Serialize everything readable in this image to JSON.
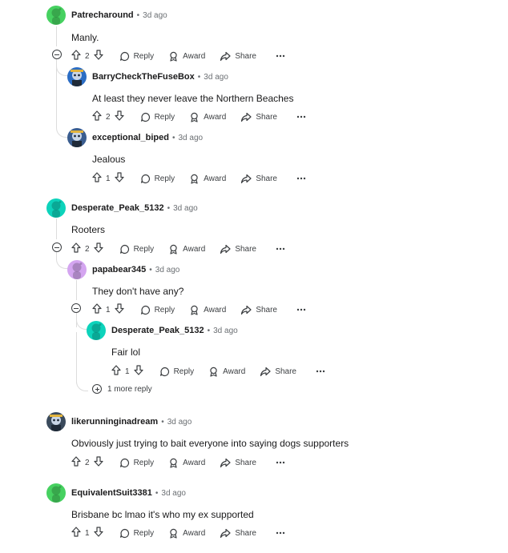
{
  "comments": [
    {
      "user": "Patrecharound",
      "time": "3d ago",
      "text": "Manly.",
      "votes": "2",
      "avatar_color": "#46d160"
    },
    {
      "user": "BarryCheckTheFuseBox",
      "time": "3d ago",
      "text": "At least they never leave the Northern Beaches",
      "votes": "2",
      "avatar_color": "#2b6dc4"
    },
    {
      "user": "exceptional_biped",
      "time": "3d ago",
      "text": "Jealous",
      "votes": "1",
      "avatar_color": "#3a5d8f"
    },
    {
      "user": "Desperate_Peak_5132",
      "time": "3d ago",
      "text": "Rooters",
      "votes": "2",
      "avatar_color": "#0dd3bb"
    },
    {
      "user": "papabear345",
      "time": "3d ago",
      "text": "They don't have any?",
      "votes": "1",
      "avatar_color": "#d4a5f0"
    },
    {
      "user": "Desperate_Peak_5132",
      "time": "3d ago",
      "text": "Fair lol",
      "votes": "1",
      "avatar_color": "#0dd3bb"
    },
    {
      "user": "likerunninginadream",
      "time": "3d ago",
      "text": "Obviously just trying to bait everyone into saying dogs supporters",
      "votes": "2",
      "avatar_color": "#3a4a5c"
    },
    {
      "user": "EquivalentSuit3381",
      "time": "3d ago",
      "text": "Brisbane bc lmao it's who my ex supported",
      "votes": "1",
      "avatar_color": "#46d160"
    }
  ],
  "labels": {
    "reply": "Reply",
    "award": "Award",
    "share": "Share",
    "more_replies": "1 more reply",
    "dot": "•"
  },
  "icons": [
    "upvote-icon",
    "downvote-icon",
    "reply-icon",
    "award-icon",
    "share-icon",
    "overflow-icon",
    "collapse-icon",
    "expand-icon"
  ]
}
